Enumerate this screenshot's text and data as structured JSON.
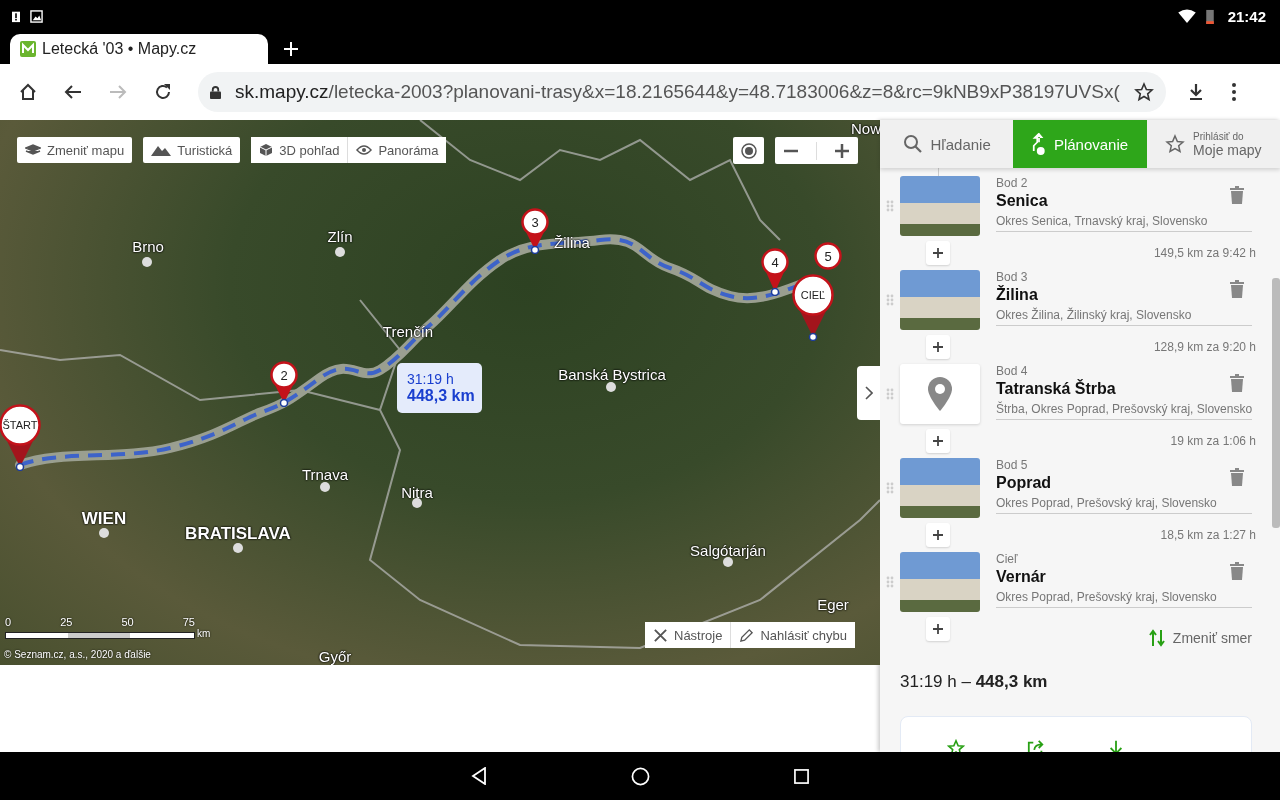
{
  "status_bar": {
    "time": "21:42"
  },
  "browser": {
    "tab": {
      "title": "Letecká '03 • Mapy.cz"
    },
    "url": {
      "host": "sk.mapy.cz",
      "path": "/letecka-2003?planovani-trasy&x=18.2165644&y=48.7183006&z=8&rc=9kNB9xP38197UVSx("
    }
  },
  "map": {
    "toolbar": [
      {
        "label": "Zmeniť mapu",
        "kind": "layers"
      },
      {
        "label": "Turistická",
        "kind": "mountain"
      },
      {
        "label": "3D pohľad",
        "kind": "cube"
      },
      {
        "label": "Panoráma",
        "kind": "eye"
      }
    ],
    "places": [
      {
        "name": "Brno",
        "kind": "city"
      },
      {
        "name": "Zlín",
        "kind": "city"
      },
      {
        "name": "Trenčín",
        "kind": "city"
      },
      {
        "name": "Žilina",
        "kind": "city"
      },
      {
        "name": "Banská Bystrica",
        "kind": "city"
      },
      {
        "name": "Trnava",
        "kind": "city"
      },
      {
        "name": "Nitra",
        "kind": "city"
      },
      {
        "name": "WIEN",
        "kind": "capital"
      },
      {
        "name": "BRATISLAVA",
        "kind": "capital"
      },
      {
        "name": "Salgótarján",
        "kind": "city"
      },
      {
        "name": "Eger",
        "kind": "city"
      },
      {
        "name": "Győr",
        "kind": "city"
      },
      {
        "name": "Now",
        "kind": "city"
      }
    ],
    "pins": [
      {
        "label": "ŠTART",
        "kind": "end"
      },
      {
        "label": "2",
        "kind": "via"
      },
      {
        "label": "3",
        "kind": "via"
      },
      {
        "label": "4",
        "kind": "via"
      },
      {
        "label": "5",
        "kind": "via"
      },
      {
        "label": "CIEĽ",
        "kind": "end"
      }
    ],
    "route_tooltip": {
      "time": "31:19 h",
      "distance": "448,3 km"
    },
    "scale": {
      "ticks": [
        "0",
        "25",
        "50",
        "75"
      ],
      "unit": "km"
    },
    "copyright": "© Seznam.cz, a.s., 2020 a ďalšie",
    "bottom_buttons": [
      {
        "label": "Nástroje",
        "kind": "tools"
      },
      {
        "label": "Nahlásiť chybu",
        "kind": "pencil"
      }
    ]
  },
  "sidebar": {
    "tabs": [
      {
        "label": "Hľadanie",
        "kind": "search",
        "selected": false
      },
      {
        "label": "Plánovanie",
        "kind": "route",
        "selected": true
      },
      {
        "label": "Moje mapy",
        "caption": "Prihlásiť do",
        "kind": "star",
        "selected": false
      }
    ],
    "waypoints": [
      {
        "label": "Bod 2",
        "name": "Senica",
        "region": "Okres Senica, Trnavský kraj, Slovensko",
        "kind": "photo",
        "segment": "149,5 km za 9:42 h"
      },
      {
        "label": "Bod 3",
        "name": "Žilina",
        "region": "Okres Žilina, Žilinský kraj, Slovensko",
        "kind": "photo",
        "segment": "128,9 km za 9:20 h"
      },
      {
        "label": "Bod 4",
        "name": "Tatranská Štrba",
        "region": "Štrba, Okres Poprad, Prešovský kraj, Slovensko",
        "kind": "pin",
        "segment": "19 km za 1:06 h"
      },
      {
        "label": "Bod 5",
        "name": "Poprad",
        "region": "Okres Poprad, Prešovský kraj, Slovensko",
        "kind": "photo",
        "segment": "18,5 km za 1:27 h"
      },
      {
        "label": "Cieľ",
        "name": "Vernár",
        "region": "Okres Poprad, Prešovský kraj, Slovensko",
        "kind": "photo"
      }
    ],
    "reverse": "Zmeniť smer",
    "summary": {
      "time": "31:19 h –",
      "distance": "448,3 km"
    }
  }
}
